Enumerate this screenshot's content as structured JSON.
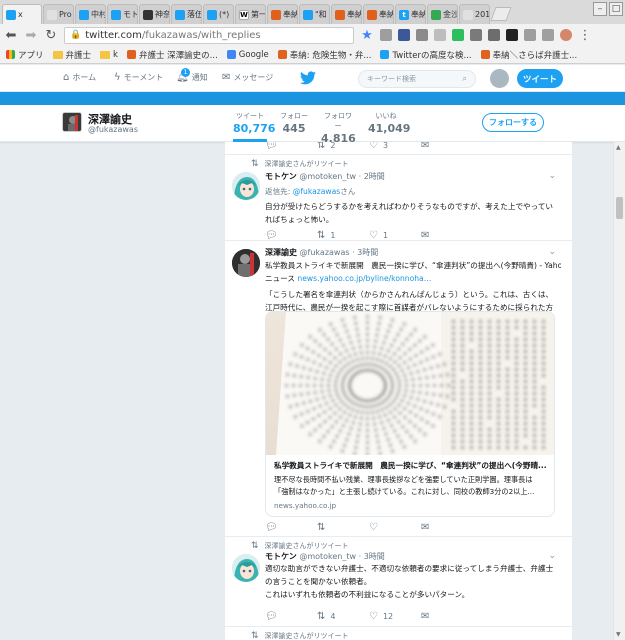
{
  "browser": {
    "tabs": [
      {
        "label": "x",
        "fav": "#1da1f2",
        "glyph": "🐦"
      },
      {
        "label": "Pro",
        "fav": "#e0e0e0",
        "glyph": ""
      },
      {
        "label": "中村",
        "fav": "#1da1f2",
        "glyph": "🐦"
      },
      {
        "label": "モト",
        "fav": "#1da1f2",
        "glyph": "🐦"
      },
      {
        "label": "神奈",
        "fav": "#333333",
        "glyph": ""
      },
      {
        "label": "落伍",
        "fav": "#1da1f2",
        "glyph": "🐦"
      },
      {
        "label": "(*)",
        "fav": "#1da1f2",
        "glyph": "🐦"
      },
      {
        "label": "第一",
        "fav": "#ffffff",
        "glyph": "W"
      },
      {
        "label": "奉納",
        "fav": "#e06020",
        "glyph": ""
      },
      {
        "label": "\"和",
        "fav": "#1da1f2",
        "glyph": "🐦"
      },
      {
        "label": "奉納",
        "fav": "#e06020",
        "glyph": ""
      },
      {
        "label": "奉納",
        "fav": "#e06020",
        "glyph": ""
      },
      {
        "label": "奉納",
        "fav": "#1da1f2",
        "glyph": "t"
      },
      {
        "label": "金沙",
        "fav": "#34a853",
        "glyph": ""
      },
      {
        "label": "201",
        "fav": "#e0e0e0",
        "glyph": ""
      }
    ],
    "url_host": "twitter.com",
    "url_path": "/fukazawas/with_replies",
    "bookmarks": [
      {
        "label": "アプリ",
        "kind": "apps"
      },
      {
        "label": "弁護士",
        "kind": "folder"
      },
      {
        "label": "k",
        "kind": "folder"
      },
      {
        "label": "弁護士 深澤諭史の...",
        "kind": "page"
      },
      {
        "label": "Google",
        "kind": "page"
      },
      {
        "label": "奉納: 危険生物・弁...",
        "kind": "page"
      },
      {
        "label": "Twitterの高度な検...",
        "kind": "page"
      },
      {
        "label": "奉納＼さらば弁護士...",
        "kind": "page"
      }
    ]
  },
  "twnav": {
    "home": "ホーム",
    "moments": "モーメント",
    "notifications": "通知",
    "notif_count": "1",
    "messages": "メッセージ",
    "search_placeholder": "キーワード検索",
    "tweet_button": "ツイート"
  },
  "profile": {
    "name": "深澤諭史",
    "handle": "@fukazawas",
    "stats": [
      {
        "label": "ツイート",
        "value": "80,776",
        "active": true
      },
      {
        "label": "フォロー",
        "value": "445",
        "active": false
      },
      {
        "label": "フォロワー",
        "value": "4,816",
        "active": false
      },
      {
        "label": "いいね",
        "value": "41,049",
        "active": false
      }
    ],
    "follow_button": "フォローする"
  },
  "top_actions": {
    "retweets": "2",
    "likes": "3"
  },
  "tweets": [
    {
      "retweeted_by": "深澤諭史さんがリツイート",
      "name": "モトケン",
      "handle": "@motoken_tw",
      "time": "· 2時間",
      "reply_prefix": "返信先: ",
      "reply_handle": "@fukazawas",
      "reply_suffix": "さん",
      "text": "自分が受けたらどうするかを考えればわかりそうなものですが、考えた上でやっていればちょっと怖い。",
      "replies": "",
      "retweets": "1",
      "likes": "1"
    },
    {
      "name": "深澤諭史",
      "handle": "@fukazawas",
      "time": "· 3時間",
      "text_line1": "私学教員ストライキで新展開　農民一揆に学び、“傘連判状”の提出へ(今野晴貴) - Yahoo!",
      "text_line2_prefix": "ニュース ",
      "link": "news.yahoo.co.jp/byline/konnoha…",
      "quote": "「こうした署名を傘連判状（からかさんれんぱんじょう）という。これは、古くは、江戸時代に、農民が一揆を起こす際に首謀者がバレないようにするために採られた方法である。」",
      "card_title": "私学教員ストライキで新展開　農民一揆に学び、“傘連判状”の提出へ(今野晴...",
      "card_desc": "理不尽な長時間不払い残業、理事長挨拶などを強要していた正則学園。理事長は「強制はなかった」と主張し続けている。これに対し、同校の教師3分の2以上...",
      "card_domain": "news.yahoo.co.jp",
      "replies": "",
      "retweets": "",
      "likes": ""
    },
    {
      "retweeted_by": "深澤諭史さんがリツイート",
      "name": "モトケン",
      "handle": "@motoken_tw",
      "time": "· 3時間",
      "text_line1": "適切な助言ができない弁護士、不適切な依頼者の要求に従ってしまう弁護士、弁護士",
      "text_line2": "の言うことを聞かない依頼者。",
      "text_line3": "これはいずれも依頼者の不利益になることが多いパターン。",
      "replies": "",
      "retweets": "4",
      "likes": "12"
    },
    {
      "retweeted_by": "深澤諭史さんがリツイート"
    }
  ],
  "colors": {
    "accent": "#1da1f2",
    "banner": "#1b95e0",
    "text": "#14171a",
    "muted": "#657786"
  }
}
